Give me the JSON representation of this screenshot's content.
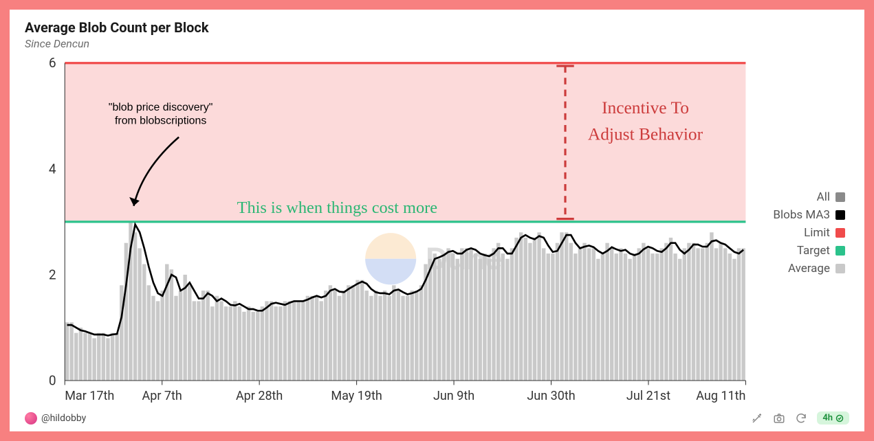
{
  "title": "Average Blob Count per Block",
  "subtitle": "Since Dencun",
  "author": "@hildobby",
  "refresh_label": "4h",
  "watermark": "Dune",
  "legend": {
    "all": "All",
    "blobs_ma3": "Blobs MA3",
    "limit": "Limit",
    "target": "Target",
    "average": "Average"
  },
  "colors": {
    "all_swatch": "#8a8a8a",
    "blobs_ma3_swatch": "#000000",
    "limit_swatch": "#f04b4b",
    "target_swatch": "#2bc28b",
    "average_swatch": "#c9c9c9",
    "shade_fill": "#fcdada",
    "annotation_green": "#2bb673",
    "annotation_red": "#cc3b3b"
  },
  "annotations": {
    "blob_price_line1": "\"blob price discovery\"",
    "blob_price_line2": "from blobscriptions",
    "cost_more": "This is when things cost more",
    "incentive_line1": "Incentive To",
    "incentive_line2": "Adjust Behavior"
  },
  "chart_data": {
    "type": "bar",
    "ylabel": "",
    "xlabel": "",
    "ylim": [
      0,
      6
    ],
    "yticks": [
      0,
      2,
      4,
      6
    ],
    "limit": 6,
    "target": 3,
    "categories": [
      "Mar 17th",
      "Apr 7th",
      "Apr 28th",
      "May 19th",
      "Jun 9th",
      "Jun 30th",
      "Jul 21st",
      "Aug 11th"
    ],
    "series": [
      {
        "name": "All",
        "values": [
          1.1,
          1.1,
          0.9,
          1.0,
          0.9,
          0.9,
          0.8,
          0.9,
          0.9,
          0.8,
          0.9,
          0.9,
          1.8,
          2.6,
          3.0,
          2.8,
          2.5,
          2.2,
          1.8,
          1.6,
          1.5,
          1.7,
          2.2,
          2.1,
          1.6,
          1.7,
          2.0,
          1.8,
          1.5,
          1.5,
          1.7,
          1.7,
          1.4,
          1.6,
          1.5,
          1.4,
          1.4,
          1.5,
          1.4,
          1.3,
          1.4,
          1.3,
          1.3,
          1.4,
          1.5,
          1.5,
          1.4,
          1.4,
          1.5,
          1.5,
          1.5,
          1.5,
          1.5,
          1.6,
          1.6,
          1.6,
          1.5,
          1.7,
          1.8,
          1.7,
          1.6,
          1.7,
          1.8,
          1.8,
          1.9,
          1.9,
          1.7,
          1.6,
          1.7,
          1.6,
          1.7,
          1.6,
          1.8,
          1.7,
          1.6,
          1.6,
          1.7,
          1.7,
          1.8,
          2.2,
          2.3,
          2.4,
          2.3,
          2.4,
          2.5,
          2.4,
          2.3,
          2.5,
          2.5,
          2.5,
          2.4,
          2.3,
          2.4,
          2.3,
          2.5,
          2.6,
          2.4,
          2.3,
          2.5,
          2.7,
          2.8,
          2.7,
          2.6,
          2.7,
          2.8,
          2.5,
          2.4,
          2.4,
          2.6,
          2.8,
          2.8,
          2.6,
          2.4,
          2.5,
          2.6,
          2.5,
          2.5,
          2.3,
          2.4,
          2.6,
          2.5,
          2.4,
          2.5,
          2.4,
          2.3,
          2.4,
          2.5,
          2.6,
          2.5,
          2.4,
          2.4,
          2.5,
          2.6,
          2.7,
          2.4,
          2.3,
          2.5,
          2.6,
          2.6,
          2.5,
          2.5,
          2.6,
          2.8,
          2.5,
          2.6,
          2.5,
          2.4,
          2.3,
          2.5,
          2.5
        ]
      },
      {
        "name": "Blobs MA3",
        "values": [
          1.05,
          1.05,
          1.0,
          0.95,
          0.93,
          0.9,
          0.87,
          0.87,
          0.87,
          0.85,
          0.87,
          0.88,
          1.2,
          1.8,
          2.5,
          2.95,
          2.8,
          2.5,
          2.15,
          1.85,
          1.65,
          1.6,
          1.8,
          2.0,
          1.95,
          1.7,
          1.75,
          1.85,
          1.7,
          1.55,
          1.55,
          1.65,
          1.6,
          1.5,
          1.55,
          1.5,
          1.43,
          1.42,
          1.45,
          1.4,
          1.35,
          1.35,
          1.32,
          1.32,
          1.38,
          1.45,
          1.47,
          1.45,
          1.43,
          1.47,
          1.5,
          1.5,
          1.5,
          1.53,
          1.57,
          1.6,
          1.57,
          1.6,
          1.7,
          1.73,
          1.68,
          1.67,
          1.73,
          1.78,
          1.83,
          1.87,
          1.83,
          1.73,
          1.67,
          1.65,
          1.65,
          1.63,
          1.7,
          1.72,
          1.67,
          1.63,
          1.65,
          1.68,
          1.73,
          1.9,
          2.1,
          2.3,
          2.33,
          2.37,
          2.43,
          2.45,
          2.4,
          2.4,
          2.47,
          2.5,
          2.47,
          2.4,
          2.37,
          2.35,
          2.4,
          2.5,
          2.5,
          2.4,
          2.4,
          2.55,
          2.7,
          2.75,
          2.7,
          2.67,
          2.73,
          2.7,
          2.55,
          2.43,
          2.45,
          2.6,
          2.75,
          2.75,
          2.6,
          2.5,
          2.53,
          2.55,
          2.52,
          2.45,
          2.4,
          2.45,
          2.52,
          2.48,
          2.45,
          2.47,
          2.4,
          2.37,
          2.4,
          2.48,
          2.53,
          2.5,
          2.45,
          2.43,
          2.5,
          2.6,
          2.6,
          2.47,
          2.4,
          2.47,
          2.57,
          2.57,
          2.53,
          2.53,
          2.63,
          2.65,
          2.6,
          2.57,
          2.5,
          2.43,
          2.4,
          2.47
        ]
      }
    ]
  }
}
